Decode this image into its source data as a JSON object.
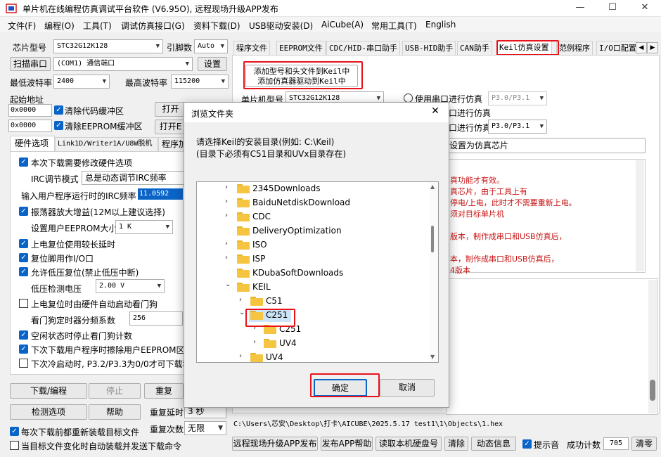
{
  "window": {
    "title": "单片机在线编程仿真调试平台软件 (V6.95O), 远程现场升级APP发布",
    "minimize": "—",
    "maximize": "☐",
    "close": "✕"
  },
  "menu": [
    "文件(F)",
    "编程(O)",
    "工具(T)",
    "调试仿真接口(G)",
    "资料下载(D)",
    "USB驱动安装(D)",
    "AiCube(A)",
    "常用工具(T)",
    "English"
  ],
  "left": {
    "chip_label": "芯片型号",
    "chip_value": "STC32G12K128",
    "pins_label": "引脚数",
    "pins_value": "Auto",
    "scan_button": "扫描串口",
    "port_value": "(COM1) 通信端口",
    "settings_button": "设置",
    "min_baud_label": "最低波特率",
    "min_baud_value": "2400",
    "max_baud_label": "最高波特率",
    "max_baud_value": "115200",
    "start_addr_label": "起始地址",
    "addr1": "0x0000",
    "clear_code": "清除代码缓冲区",
    "open1": "打开",
    "addr2": "0x0000",
    "clear_eeprom": "清除EEPROM缓冲区",
    "open2": "打开E",
    "subtabs": [
      "硬件选项",
      "Link1D/Writer1A/U8W脱机",
      "程序加"
    ],
    "opts": {
      "o1": "本次下载需要修改硬件选项",
      "irc_mode_label": "IRC调节模式",
      "irc_mode_value": "总是动态调节IRC频率",
      "irc_freq_label": "输入用户程序运行时的IRC频率",
      "irc_freq_value": "11.0592",
      "o2": "振荡器放大增益(12M以上建议选择)",
      "eeprom_size_label": "设置用户EEPROM大小",
      "eeprom_size_value": "1   K",
      "o3": "上电复位使用较长延时",
      "o4": "复位脚用作I/O口",
      "o5": "允许低压复位(禁止低压中断)",
      "lvd_label": "低压检测电压",
      "lvd_value": "2.00 V",
      "o6": "上电复位时由硬件自动启动看门狗",
      "wdt_label": "看门狗定时器分频系数",
      "wdt_value": "256",
      "o7": "空闲状态时停止看门狗计数",
      "o8": "下次下载用户程序时擦除用户EEPROM区",
      "o9": "下次冷启动时, P3.2/P3.3为0/0才可下载程"
    },
    "download_button": "下载/编程",
    "stop_button": "停止",
    "repeat_button": "重复",
    "check_button": "检测选项",
    "help_button": "帮助",
    "repeat_delay_label": "重复延时",
    "repeat_delay_value": "3 秒",
    "repeat_count_label": "重复次数",
    "repeat_count_value": "无限",
    "reload_label": "每次下载前都重新装载目标文件",
    "autoload_label": "当目标文件变化时自动装载并发送下载命令"
  },
  "right": {
    "tabs": [
      "程序文件",
      "EEPROM文件",
      "CDC/HID-串口助手",
      "USB-HID助手",
      "CAN助手",
      "Keil仿真设置",
      "范例程序",
      "I/O口配置"
    ],
    "add_btn_line1": "添加型号和头文件到Keil中",
    "add_btn_line2": "添加仿真器驱动到Keil中",
    "mcu_label": "单片机型号",
    "mcu_value": "STC32G12K128",
    "radio1": "使用串口进行仿真",
    "p_value1": "P3.0/P3.1",
    "radio2": "口进行仿真",
    "radio3": "口进行仿真",
    "p_value2": "P3.0/P3.1",
    "set_chip": "设置为仿真芯片",
    "notes": [
      "真功能才有效。",
      "真芯片，由于工具上有",
      "停电/上电，此时才不需要重新上电。",
      "须对目标单片机",
      "版本，制作成串口和USB仿真后，",
      "本，制作成串口和USB仿真后，",
      "4版本"
    ],
    "filepath": "C:\\Users\\芯安\\Desktop\\打卡\\AICUBE\\2025.5.17 test1\\1\\Objects\\1.hex",
    "bottom": {
      "remote": "远程现场升级APP发布",
      "publish_help": "发布APP帮助",
      "read_disk": "读取本机硬盘号",
      "clear": "清除",
      "dynamic": "动态信息",
      "beep": "提示音",
      "success_label": "成功计数",
      "success_value": "705",
      "clear_count": "清零"
    }
  },
  "dialog": {
    "title": "浏览文件夹",
    "close": "✕",
    "desc1": "请选择Keil的安装目录(例如: C:\\Keil)",
    "desc2": "(目录下必须有C51目录和UVx目录存在)",
    "tree": [
      {
        "label": "2345Downloads",
        "expand": "›"
      },
      {
        "label": "BaiduNetdiskDownload",
        "expand": "›"
      },
      {
        "label": "CDC",
        "expand": "›"
      },
      {
        "label": "DeliveryOptimization",
        "expand": ""
      },
      {
        "label": "ISO",
        "expand": "›"
      },
      {
        "label": "ISP",
        "expand": "›"
      },
      {
        "label": "KDubaSoftDownloads",
        "expand": ""
      },
      {
        "label": "KEIL",
        "expand": "⌄"
      },
      {
        "label": "C51",
        "expand": "›"
      },
      {
        "label": "C251",
        "expand": "⌄"
      },
      {
        "label": "C251",
        "expand": "›"
      },
      {
        "label": "UV4",
        "expand": "›"
      },
      {
        "label": "UV4",
        "expand": "›"
      }
    ],
    "ok": "确定",
    "cancel": "取消"
  },
  "colors": {
    "accent": "#0a64c8",
    "highlight": "#e8121b",
    "note_red": "#c81414",
    "folder": "#f5c542"
  }
}
